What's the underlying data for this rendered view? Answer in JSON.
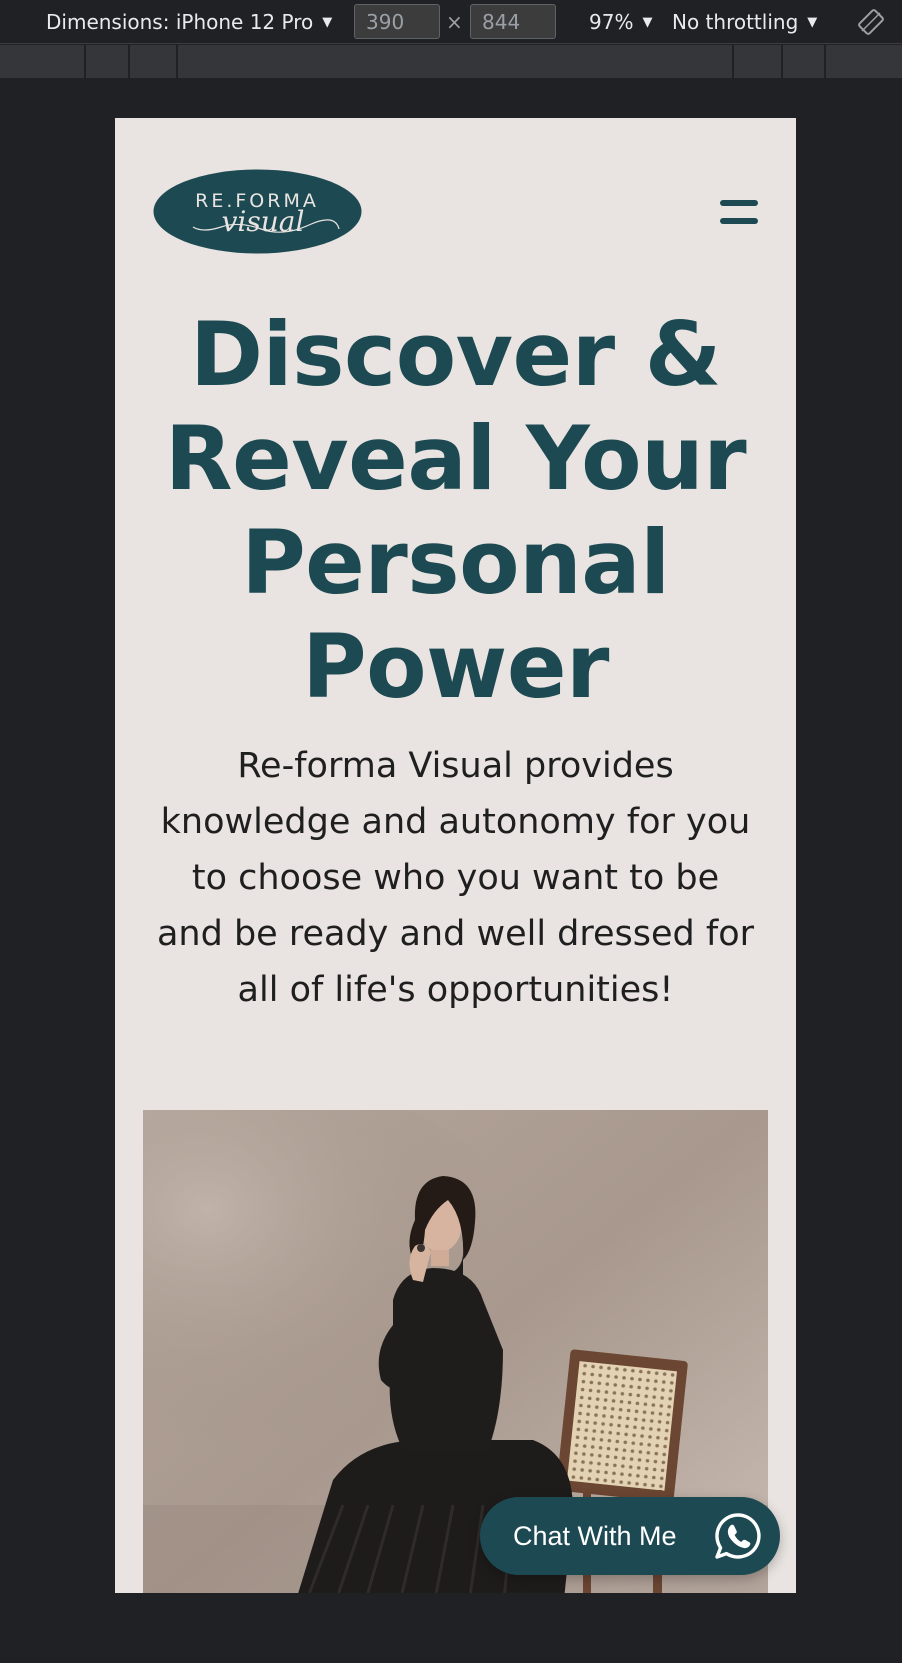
{
  "devtools": {
    "dimensions_label": "Dimensions: iPhone 12 Pro",
    "width": "390",
    "height": "844",
    "times": "×",
    "zoom": "97%",
    "throttling": "No throttling",
    "caret": "▼"
  },
  "site": {
    "logo": {
      "top_text": "RE.FORMA",
      "script_text": "visual"
    },
    "hero": {
      "title_lines": [
        "Discover &",
        "Reveal Your",
        "Personal",
        "Power"
      ],
      "subtitle_lines": [
        "Re-forma Visual provides",
        "knowledge and autonomy for you",
        "to choose who you want to be",
        "and be ready and well dressed for",
        "all of life's opportunities!"
      ]
    },
    "chat_button": {
      "label": "Chat With Me",
      "icon": "whatsapp-icon"
    },
    "colors": {
      "brand": "#1d4a52",
      "background": "#e9e4e1",
      "text": "#1f1f1f"
    }
  }
}
